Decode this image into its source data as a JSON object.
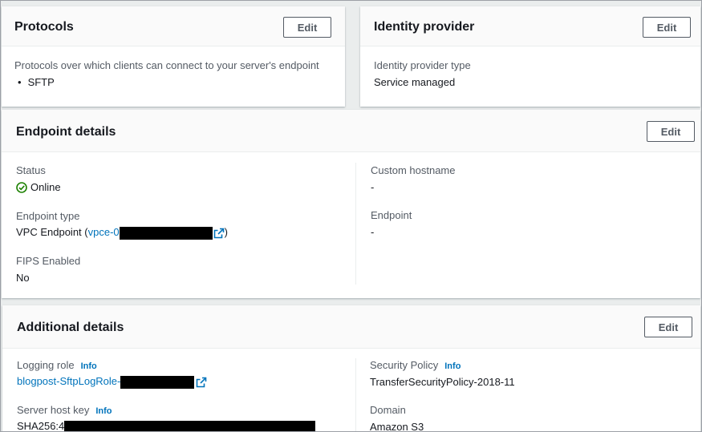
{
  "protocols": {
    "title": "Protocols",
    "edit_label": "Edit",
    "description": "Protocols over which clients can connect to your server's endpoint",
    "items": [
      "SFTP"
    ]
  },
  "identity_provider": {
    "title": "Identity provider",
    "edit_label": "Edit",
    "type_label": "Identity provider type",
    "type_value": "Service managed"
  },
  "endpoint_details": {
    "title": "Endpoint details",
    "edit_label": "Edit",
    "status_label": "Status",
    "status_value": "Online",
    "endpoint_type_label": "Endpoint type",
    "endpoint_type_value": "VPC Endpoint (",
    "endpoint_type_link": "vpce-0",
    "endpoint_type_close": ")",
    "fips_label": "FIPS Enabled",
    "fips_value": "No",
    "custom_hostname_label": "Custom hostname",
    "custom_hostname_value": "-",
    "endpoint_label": "Endpoint",
    "endpoint_value": "-"
  },
  "additional_details": {
    "title": "Additional details",
    "edit_label": "Edit",
    "logging_role_label": "Logging role",
    "info_label": "Info",
    "logging_role_value": "blogpost-SftpLogRole-",
    "server_host_key_label": "Server host key",
    "server_host_key_value": "SHA256:4",
    "security_policy_label": "Security Policy",
    "security_policy_value": "TransferSecurityPolicy-2018-11",
    "domain_label": "Domain",
    "domain_value": "Amazon S3"
  },
  "colors": {
    "link": "#0073bb",
    "success": "#1d8102",
    "text": "#16191f",
    "label": "#545b64"
  }
}
